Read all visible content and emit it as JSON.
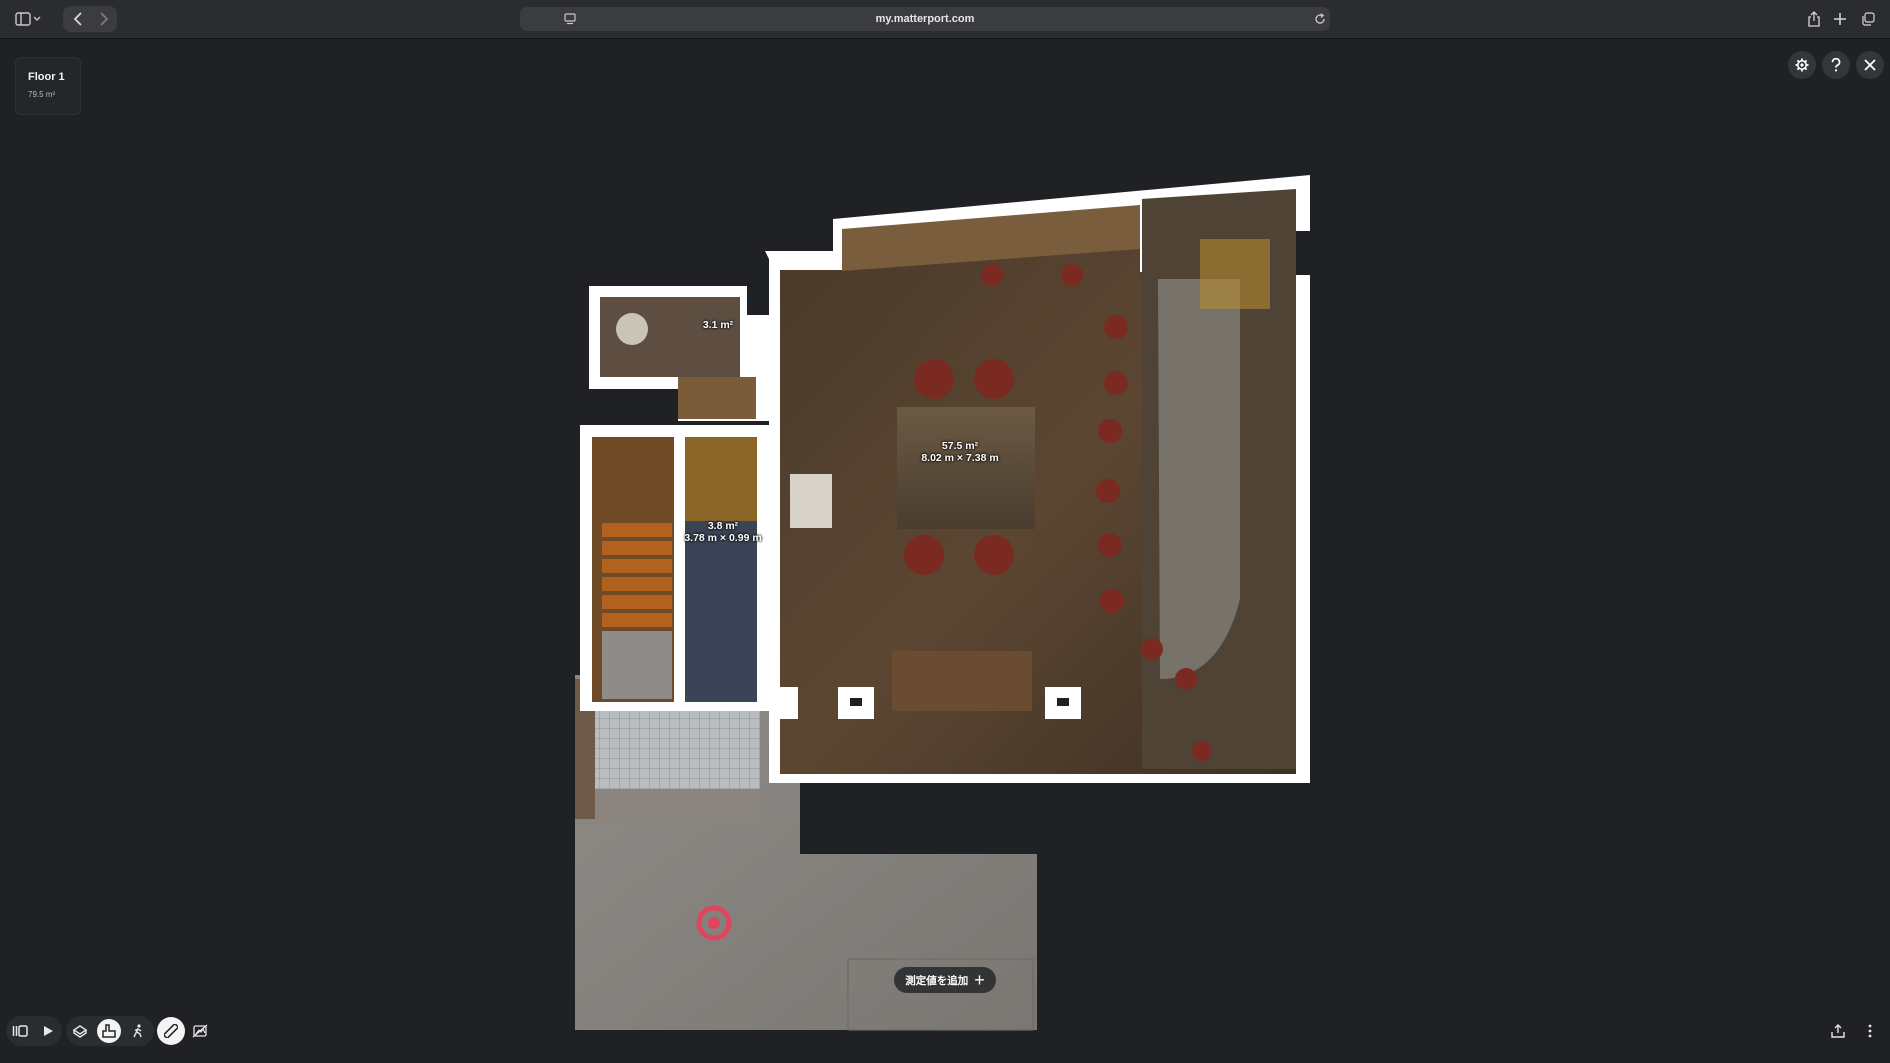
{
  "browser": {
    "url": "my.matterport.com"
  },
  "icons": {
    "sidebar": "sidebar-toggle-icon",
    "back": "chevron-left-icon",
    "forward": "chevron-right-icon",
    "shield": "privacy-shield-icon",
    "reader": "reader-icon",
    "reload": "reload-icon",
    "share": "share-icon",
    "new_tab": "plus-icon",
    "tabs": "tabs-overview-icon",
    "settings": "gear-icon",
    "help": "question-icon",
    "close": "close-icon",
    "location": "location-pin-icon"
  },
  "floor": {
    "name": "Floor 1",
    "area": "79.5 m²"
  },
  "rooms": [
    {
      "area": "3.1 m²",
      "dims": ""
    },
    {
      "area": "57.5 m²",
      "dims": "8.02 m × 7.38 m"
    },
    {
      "area": "3.8 m²",
      "dims": "3.78 m × 0.99 m"
    }
  ],
  "measure": {
    "add_label": "測定値を追加",
    "add_symbol": "+"
  },
  "colors": {
    "background": "#1f2124",
    "wall": "#ffffff",
    "floor_wood": "#5a4530",
    "concrete": "#8a8784",
    "pin": "#e0455e"
  }
}
